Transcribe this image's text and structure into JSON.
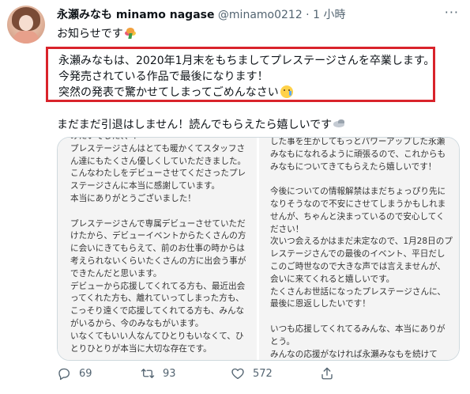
{
  "tweet": {
    "author_name": "永瀬みなも minamo nagase",
    "handle": "@minamo0212",
    "separator": " · ",
    "time": "1 小時",
    "more_icon": "more-horizontal-icon",
    "intro": "お知らせです",
    "highlight_lines": [
      "永瀬みなもは、2020年1月末をもちましてプレステージさんを卒業します。",
      "今発売されている作品で最後になります！",
      "突然の発表で驚かせてしまってごめんなさい"
    ],
    "line2": "まだまだ引退はしません！読んでもらえたら嬉しいです",
    "image_left_text": "みたいでした、、！\nプレステージさんはとても暖かくてスタッフさ\nん達にもたくさん優しくしていただきました。\nこんなわたしをデビューさせてくださったプレ\nステージさんに本当に感謝しています。\n本当にありがとうございました！\n\nプレステージさんで専属デビューさせていただ\nけたから、デビューイベントからたくさんの方\nに会いにきてもらえて、前のお仕事の時からは\n考えられないくらいたくさんの方に出会う事が\nできたんだと思います。\nデビューから応援してくれてる方も、最近出会\nってくれた方も、離れていってしまった方も、\nこっそり遠くで応援してくれてる方も、みんな\nがいるから、今のみなもがいます。\nいなくてもいい人なんてひとりもいなくて、ひ\nとりひとりが本当に大切な存在です。",
    "image_right_text": "した事を生かしてもっとパワーアップした永瀬\nみなもになれるように頑張るので、これからも\nみなもについてきてもらえたら嬉しいです！\n\n今後についての情報解禁はまだちょっぴり先に\nなりそうなので不安にさせてしまうかもしれま\nせんが、ちゃんと決まっているので安心してく\nださい！\n次いつ会えるかはまだ未定なので、1月28日のプ\nレステージさんでの最後のイベント、平日だし\nこのご時世なので大きな声では言えませんが、\n会いに来てくれると嬉しいです。\nたくさんお世話になったプレステージさんに、\n最後に恩返ししたいです！\n\nいつも応援してくれてるみんな、本当にありが\nとう。\nみんなの応援がなければ永瀬みなもを続けて",
    "stats": {
      "replies": "69",
      "retweets": "93",
      "likes": "572"
    },
    "icons": [
      "bouquet-icon",
      "crying-face-icon",
      "dove-icon",
      "reply-icon",
      "retweet-icon",
      "like-icon",
      "share-icon"
    ],
    "colors": {
      "highlight_border": "#d9232b",
      "secondary_text": "#536471"
    }
  }
}
